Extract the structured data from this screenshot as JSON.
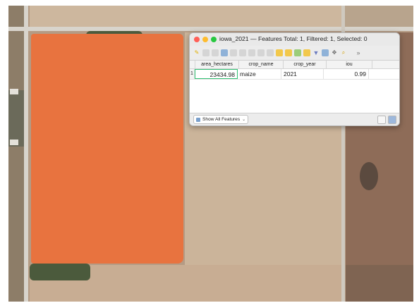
{
  "window": {
    "title": "iowa_2021 — Features Total: 1, Filtered: 1, Selected: 0"
  },
  "toolbar": {
    "icons": [
      "pencil-icon",
      "save-icon",
      "reload-icon",
      "add-feature-icon",
      "delete-icon",
      "cut-icon",
      "copy-icon",
      "paste-icon",
      "select-expression-icon",
      "select-all-icon",
      "invert-selection-icon",
      "deselect-icon",
      "filter-icon",
      "move-selection-icon",
      "pan-icon",
      "zoom-icon",
      "more-icon"
    ]
  },
  "table": {
    "columns": [
      "area_hectares",
      "crop_name",
      "crop_year",
      "iou"
    ],
    "rows": [
      {
        "num": "1",
        "area_hectares": "23434.98",
        "crop_name": "maize",
        "crop_year": "2021",
        "iou": "0.99"
      }
    ]
  },
  "bottom": {
    "show_all_label": "Show All Features"
  },
  "colors": {
    "field_polygon": "#e8733f",
    "selected_cell_border": "#2fbf71"
  }
}
